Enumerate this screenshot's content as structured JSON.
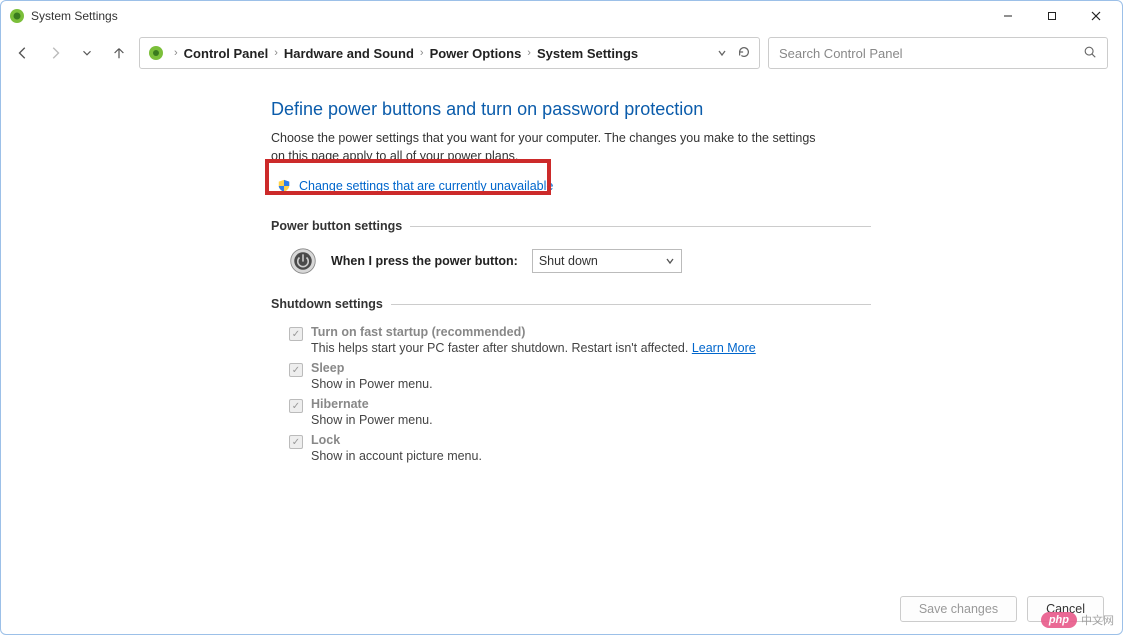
{
  "window": {
    "title": "System Settings"
  },
  "breadcrumbs": {
    "items": [
      "Control Panel",
      "Hardware and Sound",
      "Power Options",
      "System Settings"
    ]
  },
  "search": {
    "placeholder": "Search Control Panel"
  },
  "page": {
    "heading": "Define power buttons and turn on password protection",
    "description": "Choose the power settings that you want for your computer. The changes you make to the settings on this page apply to all of your power plans.",
    "change_link": "Change settings that are currently unavailable"
  },
  "power_button": {
    "group_title": "Power button settings",
    "label": "When I press the power button:",
    "value": "Shut down"
  },
  "shutdown": {
    "group_title": "Shutdown settings",
    "items": [
      {
        "label": "Turn on fast startup (recommended)",
        "sub": "This helps start your PC faster after shutdown. Restart isn't affected. ",
        "learn": "Learn More"
      },
      {
        "label": "Sleep",
        "sub": "Show in Power menu."
      },
      {
        "label": "Hibernate",
        "sub": "Show in Power menu."
      },
      {
        "label": "Lock",
        "sub": "Show in account picture menu."
      }
    ]
  },
  "footer": {
    "save": "Save changes",
    "cancel": "Cancel"
  },
  "watermark": {
    "pill": "php",
    "text": "中文网"
  }
}
